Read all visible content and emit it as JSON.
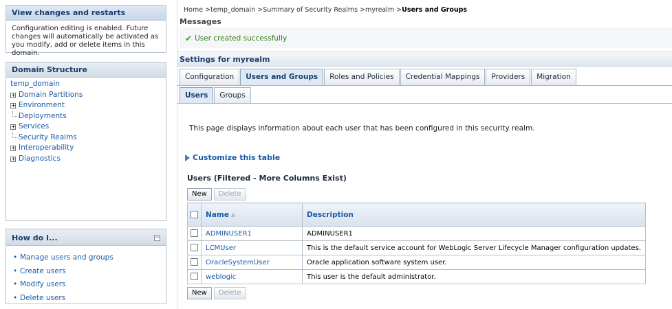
{
  "change_center": {
    "title": "View changes and restarts",
    "message": "Configuration editing is enabled. Future changes will automatically be activated as you modify, add or delete items in this domain."
  },
  "domain_structure": {
    "title": "Domain Structure",
    "root": "temp_domain",
    "nodes": [
      {
        "label": "Domain Partitions",
        "expandable": true
      },
      {
        "label": "Environment",
        "expandable": true
      },
      {
        "label": "Deployments",
        "expandable": false
      },
      {
        "label": "Services",
        "expandable": true
      },
      {
        "label": "Security Realms",
        "expandable": false
      },
      {
        "label": "Interoperability",
        "expandable": true
      },
      {
        "label": "Diagnostics",
        "expandable": true
      }
    ],
    "expand_glyph": "+"
  },
  "how_do_i": {
    "title": "How do I...",
    "collapse_glyph": "−",
    "links": [
      "Manage users and groups",
      "Create users",
      "Modify users",
      "Delete users"
    ]
  },
  "breadcrumb": {
    "path": "Home >temp_domain >Summary of Security Realms >myrealm >",
    "current": "Users and Groups"
  },
  "messages": {
    "title": "Messages",
    "success_icon": "check-icon",
    "success_glyph": "✔",
    "text": "User created successfully"
  },
  "settings": {
    "title": "Settings for myrealm",
    "tabs": [
      "Configuration",
      "Users and Groups",
      "Roles and Policies",
      "Credential Mappings",
      "Providers",
      "Migration"
    ],
    "active_tab": "Users and Groups",
    "subtabs": [
      "Users",
      "Groups"
    ],
    "active_subtab": "Users"
  },
  "page_description": "This page displays information about each user that has been configured in this security realm.",
  "customize_link": "Customize this table",
  "users_table": {
    "title": "Users (Filtered - More Columns Exist)",
    "new_label": "New",
    "delete_label": "Delete",
    "columns": [
      "Name",
      "Description"
    ],
    "sort_glyph": "⩓",
    "rows": [
      {
        "name": "ADMINUSER1",
        "description": "ADMINUSER1"
      },
      {
        "name": "LCMUser",
        "description": "This is the default service account for WebLogic Server Lifecycle Manager configuration updates."
      },
      {
        "name": "OracleSystemUser",
        "description": "Oracle application software system user."
      },
      {
        "name": "weblogic",
        "description": "This user is the default administrator."
      }
    ]
  }
}
